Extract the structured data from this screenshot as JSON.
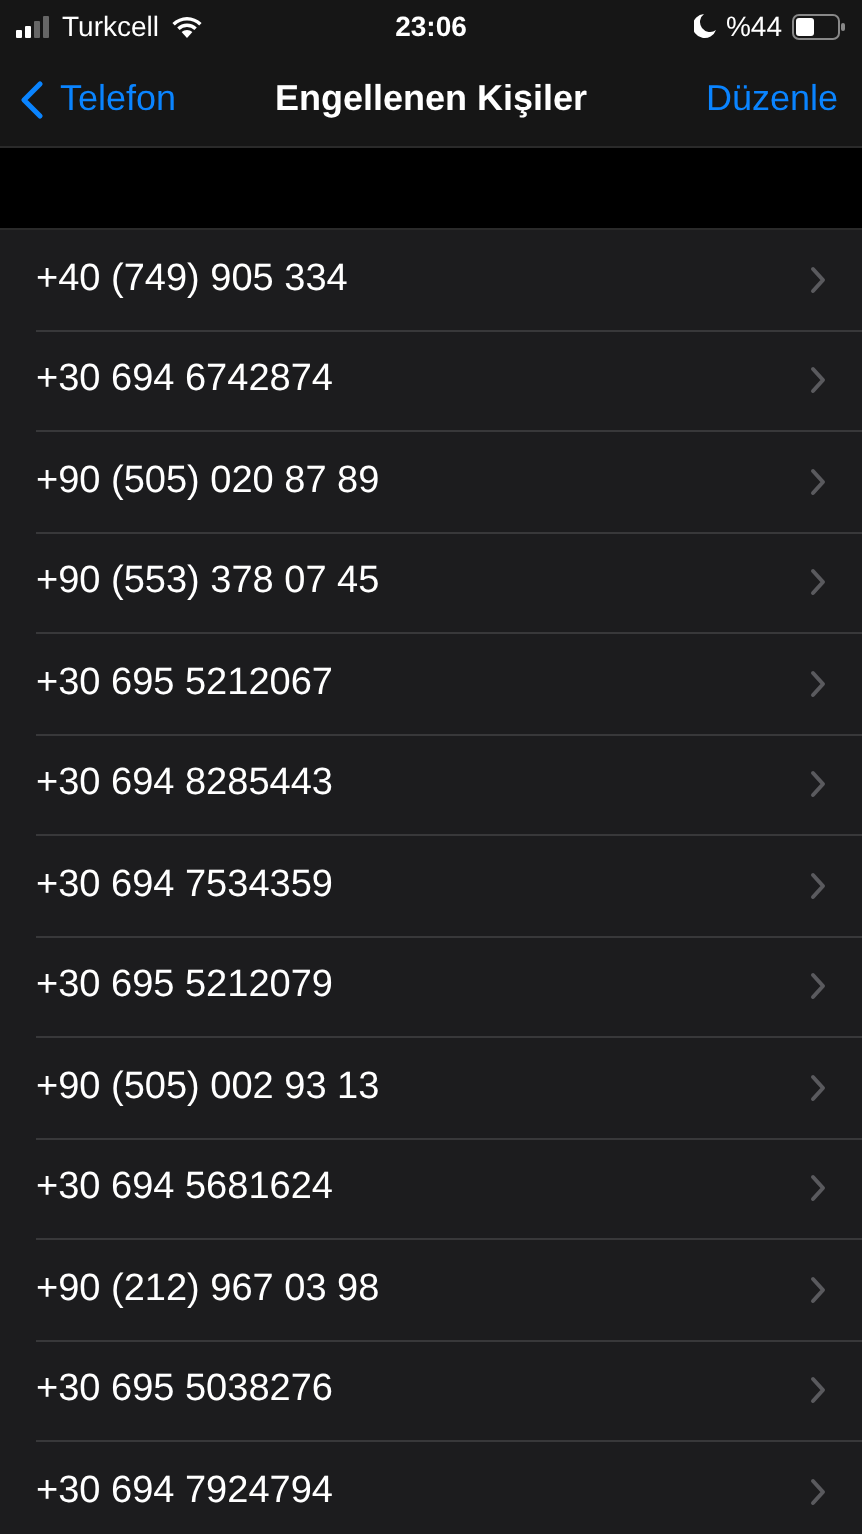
{
  "status_bar": {
    "carrier": "Turkcell",
    "time": "23:06",
    "battery": "%44"
  },
  "nav_bar": {
    "back": "Telefon",
    "title": "Engellenen Kişiler",
    "action": "Düzenle"
  },
  "blocked_numbers": [
    "+40 (749) 905 334",
    "+30 694 6742874",
    "+90 (505) 020 87 89",
    "+90 (553) 378 07 45",
    "+30 695 5212067",
    "+30 694 8285443",
    "+30 694 7534359",
    "+30 695 5212079",
    "+90 (505) 002 93 13",
    "+30 694 5681624",
    "+90 (212) 967 03 98",
    "+30 695 5038276",
    "+30 694 7924794"
  ]
}
